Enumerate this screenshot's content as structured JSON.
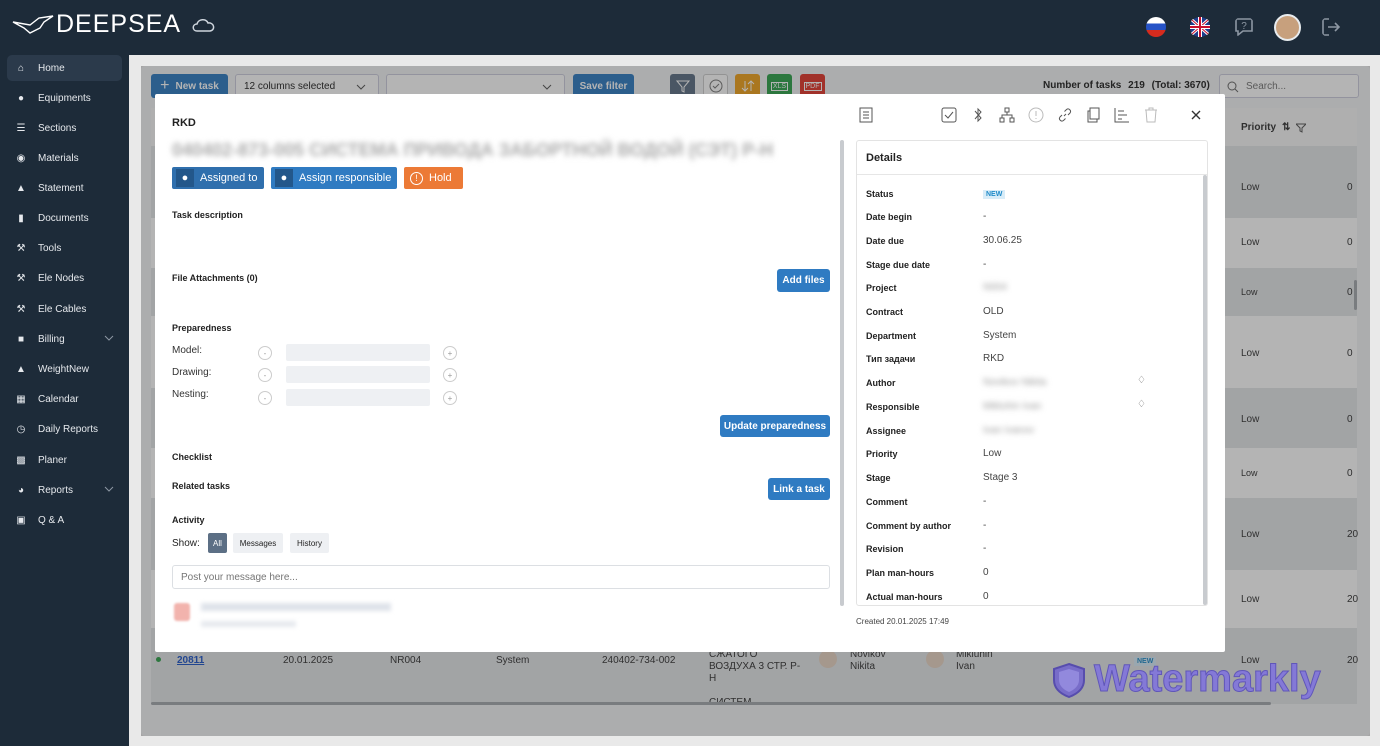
{
  "app": {
    "logo": "DEEPSEA"
  },
  "sidebar": {
    "items": [
      {
        "label": "Home",
        "icon": "home-icon"
      },
      {
        "label": "Equipments",
        "icon": "pin-icon"
      },
      {
        "label": "Sections",
        "icon": "sections-icon"
      },
      {
        "label": "Materials",
        "icon": "cube-icon"
      },
      {
        "label": "Statement",
        "icon": "triangle-icon"
      },
      {
        "label": "Documents",
        "icon": "document-icon"
      },
      {
        "label": "Tools",
        "icon": "wrench-icon"
      },
      {
        "label": "Ele Nodes",
        "icon": "wrench-icon"
      },
      {
        "label": "Ele Cables",
        "icon": "wrench-icon"
      },
      {
        "label": "Billing",
        "icon": "book-icon"
      },
      {
        "label": "WeightNew",
        "icon": "weight-icon"
      },
      {
        "label": "Calendar",
        "icon": "calendar-icon"
      },
      {
        "label": "Daily Reports",
        "icon": "clock-icon"
      },
      {
        "label": "Planer",
        "icon": "chart-icon"
      },
      {
        "label": "Reports",
        "icon": "pie-icon"
      },
      {
        "label": "Q & A",
        "icon": "qa-icon"
      }
    ]
  },
  "toolbar": {
    "new_task": "New task",
    "columns": "12 columns selected",
    "save_filter": "Save filter",
    "count_label": "Number of tasks",
    "count": "219",
    "total": "(Total: 3670)",
    "search_placeholder": "Search...",
    "priority_header": "Priority"
  },
  "grid": {
    "priorities": [
      "Low",
      "Low",
      "Low",
      "Low",
      "Low",
      "Low",
      "Low",
      "Low",
      "Low"
    ],
    "trailing": [
      "0",
      "0",
      "0",
      "0",
      "0",
      "0",
      "20",
      "20",
      "20"
    ],
    "last_row": {
      "id": "20811",
      "date": "20.01.2025",
      "code": "NR004",
      "dept": "System",
      "number": "240402-734-002",
      "title": "СЖАТОГО ВОЗДУХА 3 СТР. Р-Н",
      "next_title": "СИСТЕМ",
      "author": "Novikov Nikita",
      "responsible": "Mikluhin Ivan",
      "status": "NEW",
      "priority": "Low"
    }
  },
  "watermark": "Watermarkly",
  "modal": {
    "title": "RKD",
    "subtitle": "040402-873-005 СИСТЕМА ПРИВОДА ЗАБОРТНОЙ ВОДОЙ (СЭТ) Р-Н",
    "assigned_to": "Assigned to",
    "assign_responsible": "Assign responsible",
    "hold": "Hold",
    "task_description": "Task description",
    "attachments": "File Attachments (0)",
    "add_files": "Add files",
    "preparedness": "Preparedness",
    "prep_rows": [
      {
        "label": "Model:"
      },
      {
        "label": "Drawing:"
      },
      {
        "label": "Nesting:"
      }
    ],
    "update_prep": "Update preparedness",
    "checklist": "Checklist",
    "related": "Related tasks",
    "link_task": "Link a task",
    "activity": "Activity",
    "show": "Show:",
    "filter_all": "All",
    "filter_messages": "Messages",
    "filter_history": "History",
    "message_placeholder": "Post your message here...",
    "details": {
      "title": "Details",
      "status_label": "Status",
      "status": "NEW",
      "date_begin_label": "Date begin",
      "date_begin": "-",
      "date_due_label": "Date due",
      "date_due": "30.06.25",
      "stage_due_label": "Stage due date",
      "stage_due": "-",
      "project_label": "Project",
      "project": "N004",
      "contract_label": "Contract",
      "contract": "OLD",
      "department_label": "Department",
      "department": "System",
      "type_label": "Тип задачи",
      "type": "RKD",
      "author_label": "Author",
      "author": "Novikov Nikita",
      "responsible_label": "Responsible",
      "responsible": "Mikluhin Ivan",
      "assignee_label": "Assignee",
      "assignee": "Ivan Ivanov",
      "priority_label": "Priority",
      "priority": "Low",
      "stage_label": "Stage",
      "stage": "Stage 3",
      "comment_label": "Comment",
      "comment": "-",
      "comment_author_label": "Comment by author",
      "comment_author": "-",
      "revision_label": "Revision",
      "revision": "-",
      "plan_hours_label": "Plan man-hours",
      "plan_hours": "0",
      "actual_hours_label": "Actual man-hours",
      "actual_hours": "0",
      "created": "Created 20.01.2025 17:49"
    }
  }
}
